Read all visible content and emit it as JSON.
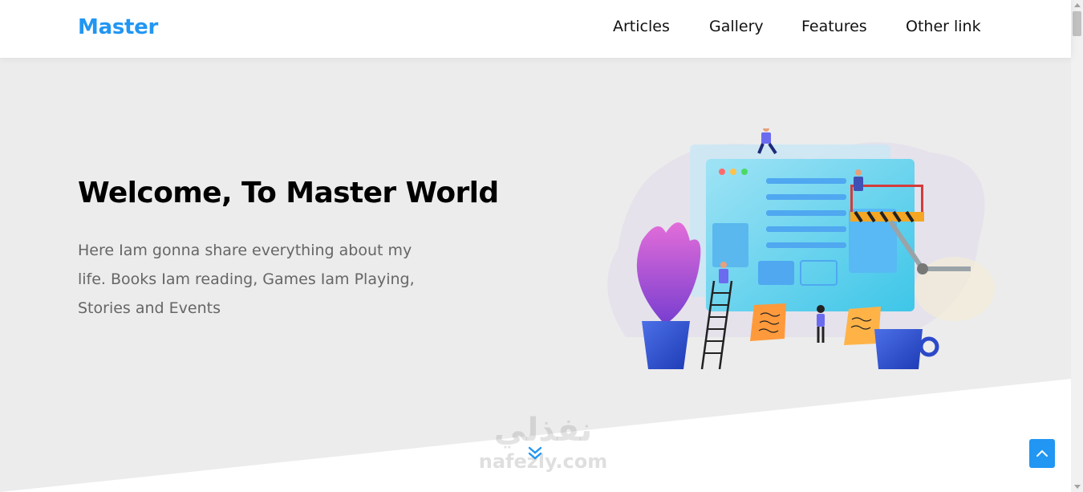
{
  "header": {
    "logo": "Master",
    "nav": [
      {
        "label": "Articles"
      },
      {
        "label": "Gallery"
      },
      {
        "label": "Features"
      },
      {
        "label": "Other link"
      }
    ]
  },
  "hero": {
    "title": "Welcome, To Master World",
    "text": "Here Iam gonna share everything about my life. Books Iam reading, Games Iam Playing, Stories and Events"
  },
  "watermark": {
    "arabic": "نفذلي",
    "latin": "nafezly.com"
  },
  "icons": {
    "scroll_down": "double-chevron-down-icon",
    "back_to_top": "chevron-up-icon"
  },
  "colors": {
    "accent": "#2196f3",
    "header_bg": "#ffffff",
    "page_bg": "#ececec",
    "title": "#000000",
    "body_text": "#666666"
  }
}
